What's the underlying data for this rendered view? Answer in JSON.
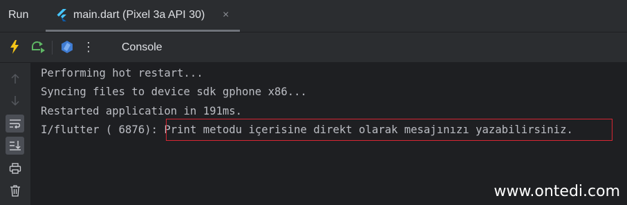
{
  "tool_window": {
    "title": "Run"
  },
  "tab": {
    "label": "main.dart (Pixel 3a API 30)",
    "icon": "flutter-icon",
    "close_symbol": "×"
  },
  "toolbar": {
    "hot_reload_icon": "lightning-icon",
    "hot_restart_icon": "restart-icon",
    "devtools_icon": "dart-devtools-icon",
    "more_symbol": "⋮",
    "console_label": "Console"
  },
  "gutter": {
    "buttons": [
      "up-arrow-icon",
      "down-arrow-icon",
      "soft-wrap-icon",
      "scroll-to-end-icon",
      "print-icon",
      "trash-icon"
    ]
  },
  "console": {
    "lines": [
      "Performing hot restart...",
      "Syncing files to device sdk gphone x86...",
      "Restarted application in 191ms."
    ],
    "flutter_prefix": "I/flutter ( 6876):",
    "flutter_message": "Print metodu içerisine direkt olarak mesajınızı yazabilirsiniz."
  },
  "watermark": "www.ontedi.com",
  "colors": {
    "background": "#2b2d30",
    "console_background": "#1e1f22",
    "text": "#bcbec4",
    "highlight_border": "#d92633",
    "hot_reload": "#f5c518",
    "hot_restart": "#5fb865"
  }
}
